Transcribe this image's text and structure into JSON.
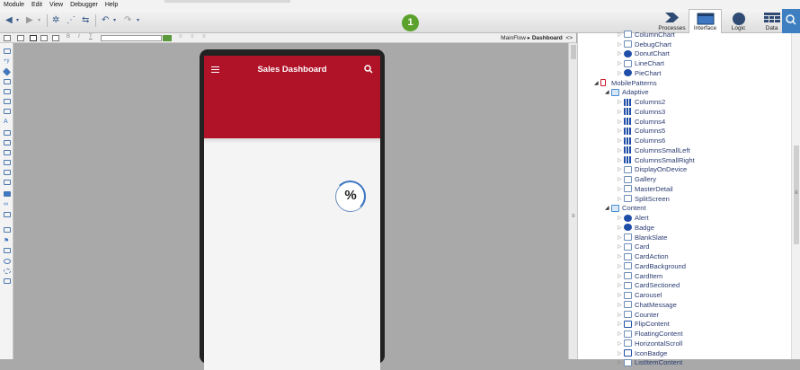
{
  "menu": [
    "Module",
    "Edit",
    "View",
    "Debugger",
    "Help"
  ],
  "step_badge": "1",
  "modes": [
    {
      "label": "Processes",
      "icon": "processes-icon",
      "active": false
    },
    {
      "label": "Interface",
      "icon": "interface-icon",
      "active": true
    },
    {
      "label": "Logic",
      "icon": "logic-icon",
      "active": false
    },
    {
      "label": "Data",
      "icon": "data-icon",
      "active": false
    }
  ],
  "breadcrumb": {
    "parent": "MainFlow",
    "separator": "▸",
    "current": "Dashboard",
    "toggle": "<>"
  },
  "screen": {
    "title": "Sales Dashboard",
    "widget_text": "%"
  },
  "colors": {
    "app_bar": "#b01228",
    "accent": "#3e77c2",
    "step_badge": "#5aa22b",
    "search_button": "#3d7fc1"
  },
  "tree": [
    {
      "label": "ColumnChart",
      "level": 3,
      "icon": "chart-icon",
      "partial": true
    },
    {
      "label": "DebugChart",
      "level": 3,
      "icon": "debug-chart-icon"
    },
    {
      "label": "DonutChart",
      "level": 3,
      "icon": "donut-chart-icon"
    },
    {
      "label": "LineChart",
      "level": 3,
      "icon": "line-chart-icon"
    },
    {
      "label": "PieChart",
      "level": 3,
      "icon": "pie-chart-icon"
    },
    {
      "label": "MobilePatterns",
      "level": 1,
      "icon": "mobile-icon",
      "open": true
    },
    {
      "label": "Adaptive",
      "level": 2,
      "icon": "folder-icon",
      "open": true
    },
    {
      "label": "Columns2",
      "level": 3,
      "icon": "columns-icon"
    },
    {
      "label": "Columns3",
      "level": 3,
      "icon": "columns-icon"
    },
    {
      "label": "Columns4",
      "level": 3,
      "icon": "columns-icon"
    },
    {
      "label": "Columns5",
      "level": 3,
      "icon": "columns-icon"
    },
    {
      "label": "Columns6",
      "level": 3,
      "icon": "columns-icon"
    },
    {
      "label": "ColumnsSmallLeft",
      "level": 3,
      "icon": "columns-icon"
    },
    {
      "label": "ColumnsSmallRight",
      "level": 3,
      "icon": "columns-icon"
    },
    {
      "label": "DisplayOnDevice",
      "level": 3,
      "icon": "device-icon"
    },
    {
      "label": "Gallery",
      "level": 3,
      "icon": "gallery-icon"
    },
    {
      "label": "MasterDetail",
      "level": 3,
      "icon": "master-detail-icon"
    },
    {
      "label": "SplitScreen",
      "level": 3,
      "icon": "split-screen-icon"
    },
    {
      "label": "Content",
      "level": 2,
      "icon": "folder-icon",
      "open": true
    },
    {
      "label": "Alert",
      "level": 3,
      "icon": "alert-icon"
    },
    {
      "label": "Badge",
      "level": 3,
      "icon": "badge-icon"
    },
    {
      "label": "BlankSlate",
      "level": 3,
      "icon": "blank-slate-icon"
    },
    {
      "label": "Card",
      "level": 3,
      "icon": "card-icon"
    },
    {
      "label": "CardAction",
      "level": 3,
      "icon": "card-action-icon"
    },
    {
      "label": "CardBackground",
      "level": 3,
      "icon": "card-background-icon"
    },
    {
      "label": "CardItem",
      "level": 3,
      "icon": "card-item-icon"
    },
    {
      "label": "CardSectioned",
      "level": 3,
      "icon": "card-sectioned-icon"
    },
    {
      "label": "Carousel",
      "level": 3,
      "icon": "carousel-icon"
    },
    {
      "label": "ChatMessage",
      "level": 3,
      "icon": "chat-message-icon"
    },
    {
      "label": "Counter",
      "level": 3,
      "icon": "counter-icon"
    },
    {
      "label": "FlipContent",
      "level": 3,
      "icon": "flip-content-icon"
    },
    {
      "label": "FloatingContent",
      "level": 3,
      "icon": "floating-content-icon"
    },
    {
      "label": "HorizontalScroll",
      "level": 3,
      "icon": "horizontal-scroll-icon"
    },
    {
      "label": "IconBadge",
      "level": 3,
      "icon": "icon-badge-icon"
    },
    {
      "label": "ListItemContent",
      "level": 3,
      "icon": "list-item-content-icon"
    }
  ]
}
